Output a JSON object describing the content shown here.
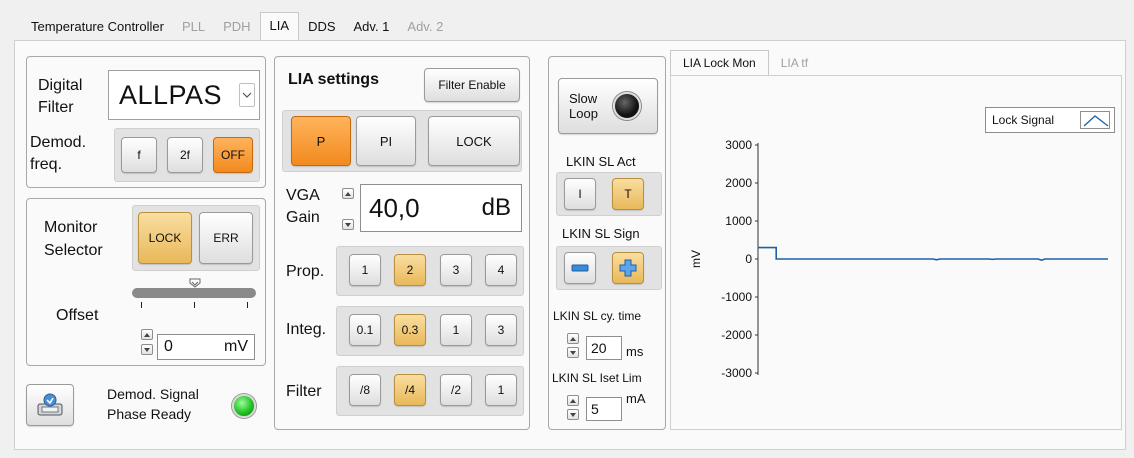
{
  "tabs": [
    {
      "label": "Temperature Controller",
      "state": "normal"
    },
    {
      "label": "PLL",
      "state": "disabled"
    },
    {
      "label": "PDH",
      "state": "disabled"
    },
    {
      "label": "LIA",
      "state": "selected"
    },
    {
      "label": "DDS",
      "state": "normal"
    },
    {
      "label": "Adv. 1",
      "state": "normal"
    },
    {
      "label": "Adv. 2",
      "state": "disabled"
    }
  ],
  "filter": {
    "label_line1": "Digital",
    "label_line2": "Filter",
    "value": "ALLPAS",
    "demod_label_line1": "Demod.",
    "demod_label_line2": "freq.",
    "demod_buttons": [
      "f",
      "2f",
      "OFF"
    ],
    "demod_selected": "OFF"
  },
  "monitor": {
    "label_line1": "Monitor",
    "label_line2": "Selector",
    "buttons": [
      "LOCK",
      "ERR"
    ],
    "selected": "LOCK",
    "offset_label": "Offset",
    "offset_value": "0",
    "offset_unit": "mV"
  },
  "bottom_left": {
    "status_line1": "Demod. Signal",
    "status_line2": "Phase Ready",
    "led_color": "#22c422"
  },
  "lia_settings": {
    "title": "LIA settings",
    "filter_enable": "Filter Enable",
    "mode_buttons": [
      "P",
      "PI",
      "LOCK"
    ],
    "mode_selected": "P",
    "vga_label_line1": "VGA",
    "vga_label_line2": "Gain",
    "vga_value": "40,0",
    "vga_unit": "dB",
    "prop_label": "Prop.",
    "prop_buttons": [
      "1",
      "2",
      "3",
      "4"
    ],
    "prop_selected": "2",
    "integ_label": "Integ.",
    "integ_buttons": [
      "0.1",
      "0.3",
      "1",
      "3"
    ],
    "integ_selected": "0.3",
    "filter_label": "Filter",
    "filter_buttons": [
      "/8",
      "/4",
      "/2",
      "1"
    ],
    "filter_selected": "/4"
  },
  "slow_loop": {
    "button_line1": "Slow",
    "button_line2": "Loop",
    "act_label": "LKIN SL Act",
    "act_buttons": [
      "I",
      "T"
    ],
    "act_selected": "T",
    "sign_label": "LKIN SL Sign",
    "sign_selected": "+",
    "cytime_label": "LKIN SL cy. time",
    "cytime_value": "20",
    "cytime_unit": "ms",
    "iset_label": "LKIN SL Iset Lim",
    "iset_value": "5",
    "iset_unit": "mA"
  },
  "chart_tabs": [
    {
      "label": "LIA Lock Mon",
      "state": "selected"
    },
    {
      "label": "LIA tf",
      "state": "disabled"
    }
  ],
  "chart_data": {
    "type": "line",
    "ylabel": "mV",
    "ylim": [
      -3000,
      3000
    ],
    "yticks": [
      "3000",
      "2000",
      "1000",
      "0",
      "-1000",
      "-2000",
      "-3000"
    ],
    "ytick_values": [
      3000,
      2000,
      1000,
      0,
      -1000,
      -2000,
      -3000
    ],
    "legend": "Lock Signal",
    "series": [
      {
        "name": "Lock Signal",
        "color": "#1f5fa8",
        "x": [
          0,
          5.2,
          5.2,
          50,
          51,
          52,
          66,
          67,
          68,
          80,
          81,
          82,
          100
        ],
        "y": [
          300,
          300,
          0,
          0,
          -20,
          0,
          0,
          -10,
          0,
          0,
          -30,
          0,
          0
        ]
      }
    ]
  }
}
